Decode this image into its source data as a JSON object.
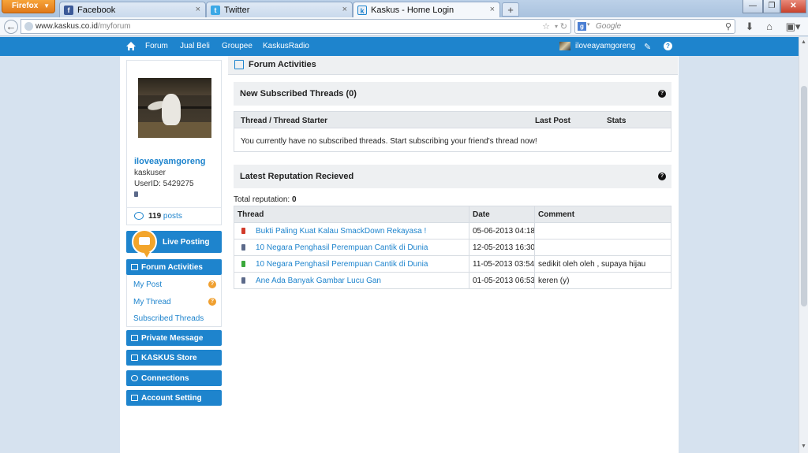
{
  "browser": {
    "app_button": "Firefox",
    "tabs": [
      {
        "label": "Facebook"
      },
      {
        "label": "Twitter"
      },
      {
        "label": "Kaskus - Home Login"
      }
    ],
    "url_domain": "www.kaskus.co.id",
    "url_path": "/myforum",
    "search_placeholder": "Google"
  },
  "site_nav": {
    "items": [
      "Forum",
      "Jual Beli",
      "Groupee",
      "KaskusRadio"
    ],
    "username": "iloveayamgoreng"
  },
  "profile": {
    "username": "iloveayamgoreng",
    "role": "kaskuser",
    "user_id": "UserID: 5429275",
    "post_count": "119",
    "posts_label": "posts"
  },
  "sidebar": {
    "live_posting": "Live Posting",
    "forum_activities": "Forum Activities",
    "my_post": "My Post",
    "my_thread": "My Thread",
    "subscribed_threads": "Subscribed Threads",
    "private_message": "Private Message",
    "kaskus_store": "KASKUS Store",
    "connections": "Connections",
    "account_setting": "Account Setting",
    "badge_text": "?"
  },
  "main": {
    "title": "Forum Activities",
    "subscribed": {
      "title": "New Subscribed Threads (0)",
      "columns": [
        "Thread / Thread Starter",
        "Last Post",
        "Stats"
      ],
      "empty_text": "You currently have no subscribed threads. Start subscribing your friend's thread now!"
    },
    "reputation": {
      "title": "Latest Reputation Recieved",
      "total_label": "Total reputation:",
      "total_value": "0",
      "columns": [
        "Thread",
        "Date",
        "Comment"
      ],
      "rows": [
        {
          "thread": "Bukti Paling Kuat Kalau SmackDown Rekayasa !",
          "date": "05-06-2013 04:18",
          "comment": "",
          "color": "#d23a2a"
        },
        {
          "thread": "10 Negara Penghasil Perempuan Cantik di Dunia",
          "date": "12-05-2013 16:30",
          "comment": "",
          "color": "#5c6a8a"
        },
        {
          "thread": "10 Negara Penghasil Perempuan Cantik di Dunia",
          "date": "11-05-2013 03:54",
          "comment": "sedikit oleh oleh , supaya hijau",
          "color": "#3aa83a"
        },
        {
          "thread": "Ane Ada Banyak Gambar Lucu Gan",
          "date": "01-05-2013 06:53",
          "comment": "keren (y)",
          "color": "#5c6a8a"
        }
      ]
    }
  },
  "colors": {
    "brand": "#1e84cd",
    "accent": "#f3a52b"
  }
}
